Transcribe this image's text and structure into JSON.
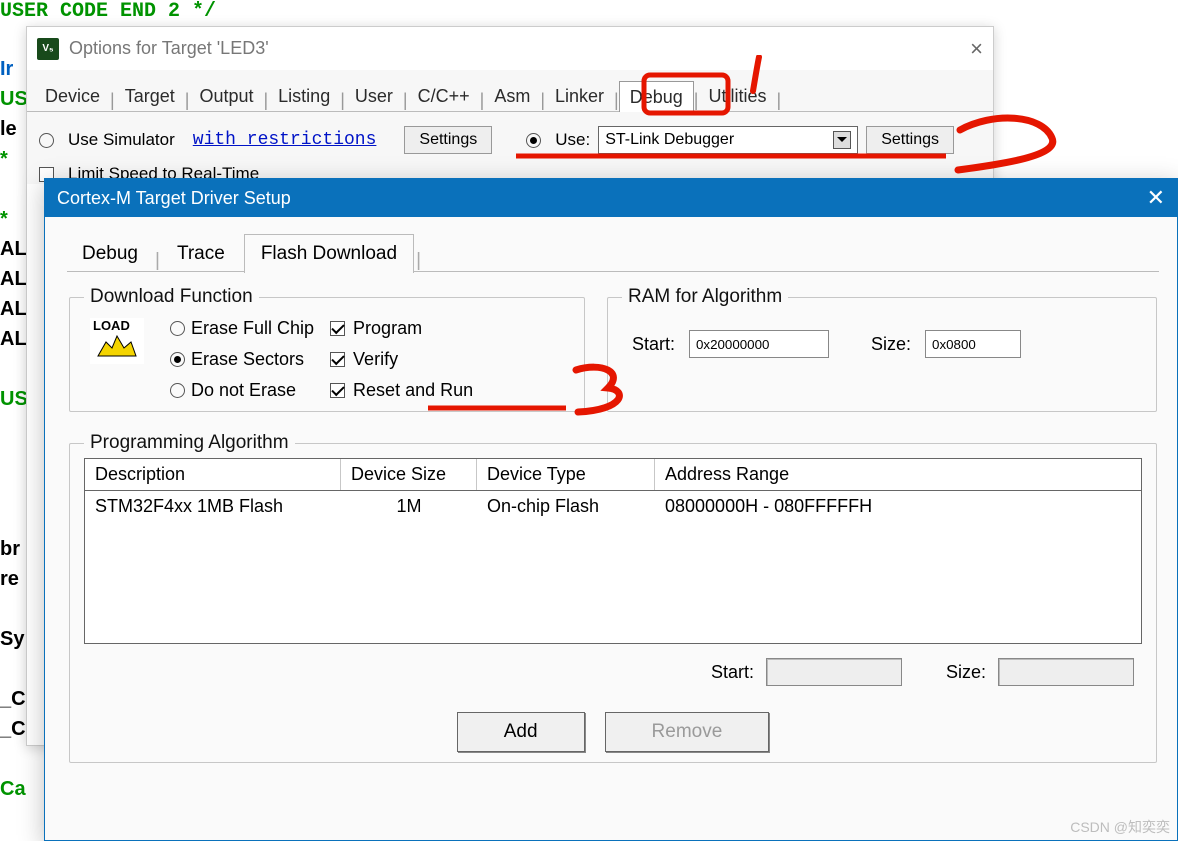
{
  "background_code": {
    "top_comment": "USER CODE END 2 */",
    "left_tokens": [
      "Ir",
      "US",
      "le",
      "*",
      "",
      "*",
      "AL",
      "AL",
      "AL",
      "AL",
      "",
      "US",
      "",
      "",
      "",
      "",
      "br",
      "re",
      "",
      "Sy",
      "",
      "_C",
      "_C",
      "",
      "Ca"
    ]
  },
  "options_window": {
    "title": "Options for Target 'LED3'",
    "close_tooltip": "Close",
    "tabs": [
      "Device",
      "Target",
      "Output",
      "Listing",
      "User",
      "C/C++",
      "Asm",
      "Linker",
      "Debug",
      "Utilities"
    ],
    "active_tab": "Debug",
    "left": {
      "use_simulator": "Use Simulator",
      "with_restrictions": "with restrictions",
      "settings": "Settings",
      "limit_speed": "Limit Speed to Real-Time"
    },
    "right": {
      "use_label": "Use:",
      "debugger_selected": "ST-Link Debugger",
      "settings": "Settings"
    }
  },
  "cortex_window": {
    "title": "Cortex-M Target Driver Setup",
    "tabs": [
      "Debug",
      "Trace",
      "Flash Download"
    ],
    "active_tab": "Flash Download",
    "download_function": {
      "legend": "Download Function",
      "erase_full_chip": "Erase Full Chip",
      "erase_sectors": "Erase Sectors",
      "do_not_erase": "Do not Erase",
      "program": "Program",
      "verify": "Verify",
      "reset_and_run": "Reset and Run",
      "load_label": "LOAD"
    },
    "ram_for_algorithm": {
      "legend": "RAM for Algorithm",
      "start_label": "Start:",
      "start_value": "0x20000000",
      "size_label": "Size:",
      "size_value": "0x0800"
    },
    "programming_algorithm": {
      "legend": "Programming Algorithm",
      "columns": [
        "Description",
        "Device Size",
        "Device Type",
        "Address Range"
      ],
      "rows": [
        {
          "desc": "STM32F4xx 1MB Flash",
          "size": "1M",
          "type": "On-chip Flash",
          "range": "08000000H - 080FFFFFH"
        }
      ],
      "start_label": "Start:",
      "size_label": "Size:",
      "add": "Add",
      "remove": "Remove"
    }
  },
  "watermark": "CSDN @知奕奕"
}
